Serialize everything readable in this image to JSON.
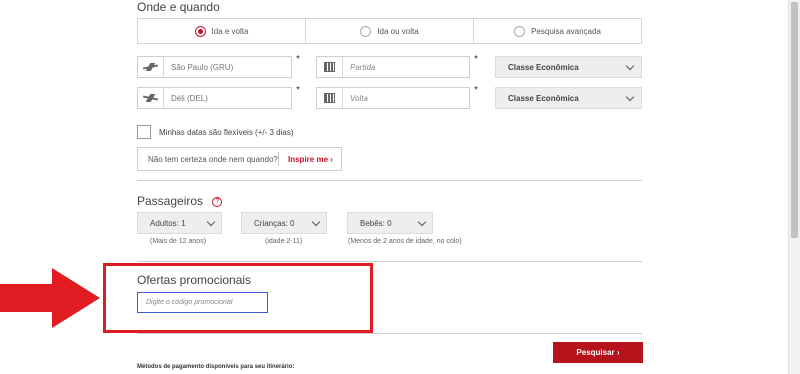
{
  "when_section": {
    "title": "Onde e quando"
  },
  "trip_type": [
    {
      "label": "Ida e volta",
      "selected": true
    },
    {
      "label": "Ida ou volta",
      "selected": false
    },
    {
      "label": "Pesquisa avançada",
      "selected": false
    }
  ],
  "origin": {
    "value": "São Paulo (GRU)",
    "icon": "plane-takeoff-icon"
  },
  "destination": {
    "value": "Déli (DEL)",
    "icon": "plane-landing-icon"
  },
  "departure_date": {
    "placeholder": "Partida",
    "icon": "calendar-icon"
  },
  "return_date": {
    "placeholder": "Volta",
    "icon": "calendar-icon"
  },
  "required_mark": "*",
  "cabin_outbound": {
    "value": "Classe Econômica"
  },
  "cabin_return": {
    "value": "Classe Econômica"
  },
  "flexible_dates": {
    "label": "Minhas datas são flexíveis (+/- 3 dias)",
    "checked": false
  },
  "inspire": {
    "question": "Não tem certeza onde nem quando?",
    "link": "Inspire me ›"
  },
  "passengers": {
    "title": "Passageiros",
    "help": "?",
    "adults": {
      "label": "Adultos: 1",
      "hint": "(Mais de 12 anos)"
    },
    "children": {
      "label": "Crianças: 0",
      "hint": "(idade 2-11)"
    },
    "infants": {
      "label": "Bebês: 0",
      "hint": "(Menos de 2 anos de idade, no colo)"
    }
  },
  "promo": {
    "title": "Ofertas promocionais",
    "placeholder": "Digite o código promocional"
  },
  "search_button": "Pesquisar ›",
  "payment_methods": "Métodos de pagamento disponíveis para seu itinerário:",
  "colors": {
    "accent": "#c8102e",
    "button": "#b5121b",
    "highlight": "#e11b22",
    "input_focus": "#3b5bd1"
  }
}
